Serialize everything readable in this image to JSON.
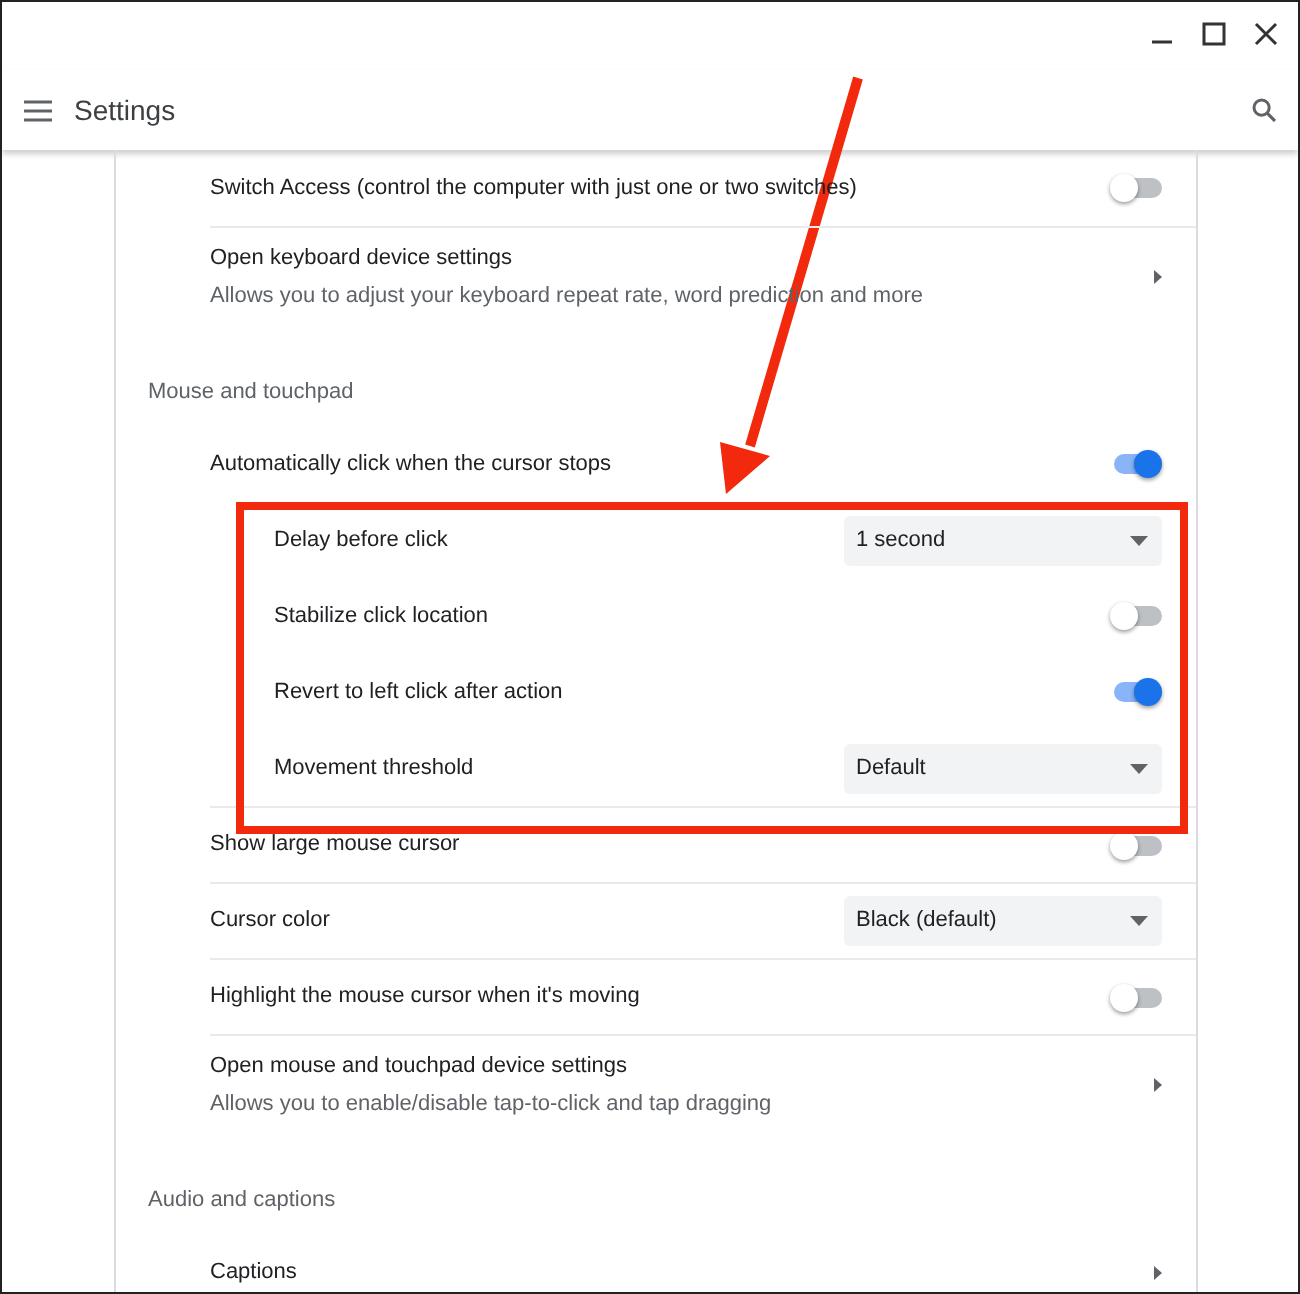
{
  "window": {
    "title": "Settings"
  },
  "sections": [
    {
      "items": [
        {
          "kind": "toggle",
          "label": "Switch Access (control the computer with just one or two switches)",
          "on": false
        },
        {
          "kind": "link",
          "label": "Open keyboard device settings",
          "description": "Allows you to adjust your keyboard repeat rate, word prediction and more"
        }
      ]
    },
    {
      "heading": "Mouse and touchpad",
      "items": [
        {
          "kind": "toggle",
          "label": "Automatically click when the cursor stops",
          "on": true,
          "children": [
            {
              "kind": "select",
              "label": "Delay before click",
              "value": "1 second"
            },
            {
              "kind": "toggle",
              "label": "Stabilize click location",
              "on": false
            },
            {
              "kind": "toggle",
              "label": "Revert to left click after action",
              "on": true
            },
            {
              "kind": "select",
              "label": "Movement threshold",
              "value": "Default"
            }
          ]
        },
        {
          "kind": "toggle",
          "label": "Show large mouse cursor",
          "on": false
        },
        {
          "kind": "select",
          "label": "Cursor color",
          "value": "Black (default)"
        },
        {
          "kind": "toggle",
          "label": "Highlight the mouse cursor when it's moving",
          "on": false
        },
        {
          "kind": "link",
          "label": "Open mouse and touchpad device settings",
          "description": "Allows you to enable/disable tap-to-click and tap dragging"
        }
      ]
    },
    {
      "heading": "Audio and captions",
      "items": [
        {
          "kind": "link",
          "label": "Captions"
        }
      ]
    }
  ]
}
